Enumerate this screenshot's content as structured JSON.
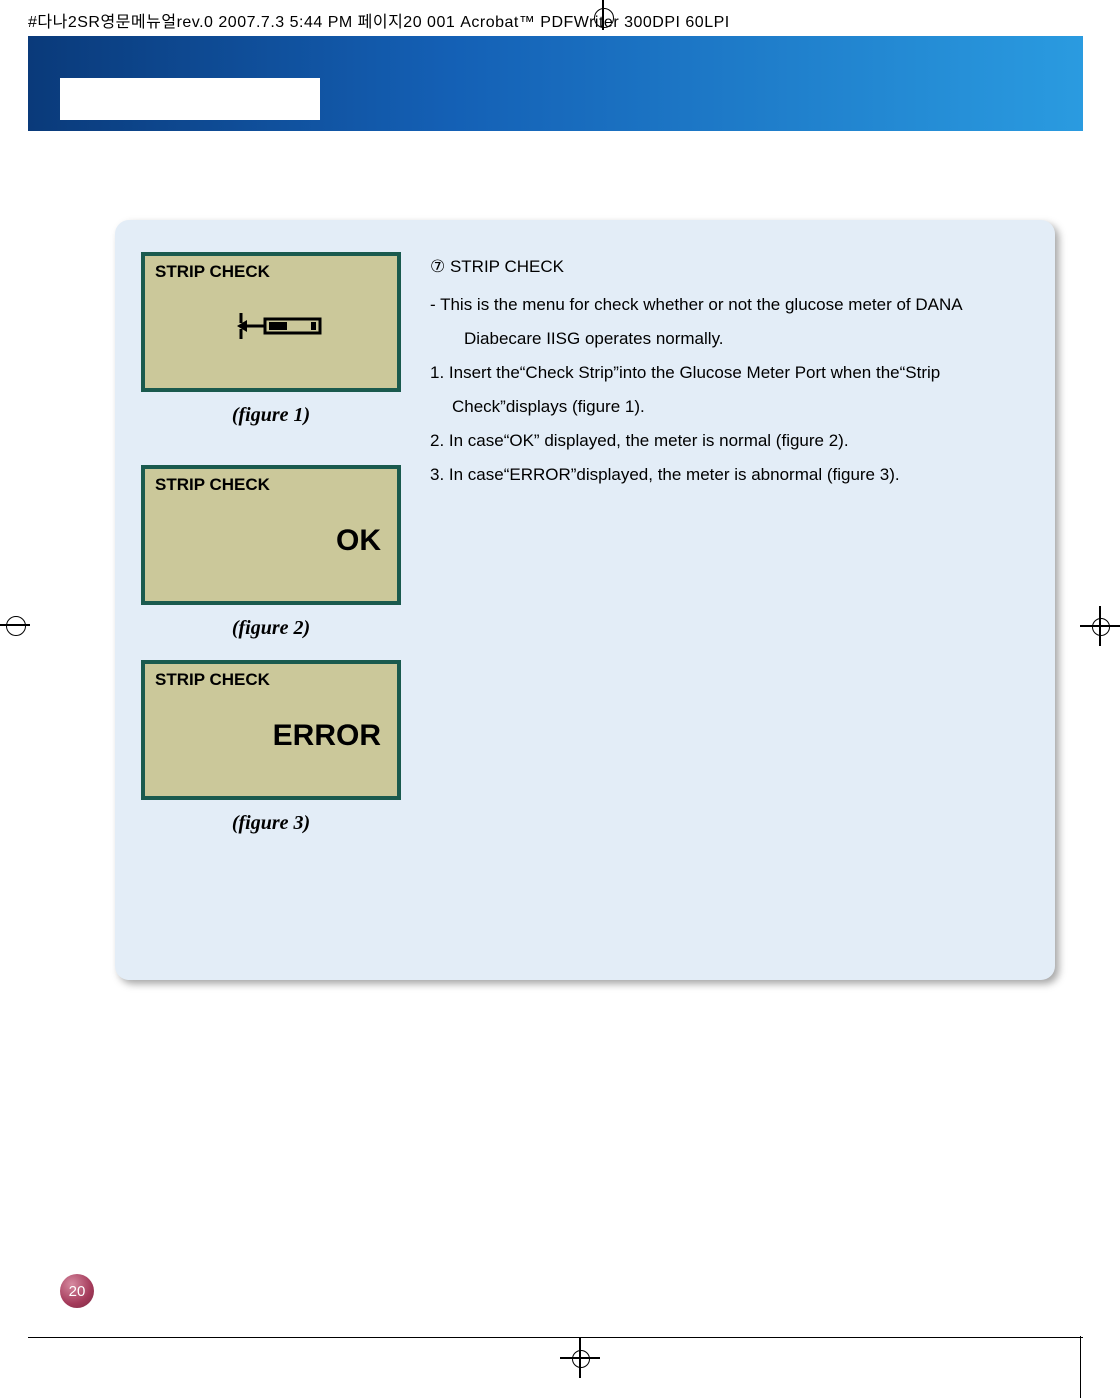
{
  "topHeader": "#다나2SR영문메뉴얼rev.0  2007.7.3 5:44 PM  페이지20   001 Acrobat™  PDFWriter 300DPI 60LPI",
  "figures": {
    "f1": {
      "label": "STRIP CHECK",
      "caption": "(figure 1)"
    },
    "f2": {
      "label": "STRIP CHECK",
      "value": "OK",
      "caption": "(figure 2)"
    },
    "f3": {
      "label": "STRIP CHECK",
      "value": "ERROR",
      "caption": "(figure 3)"
    }
  },
  "content": {
    "heading": "⑦ STRIP CHECK",
    "line1": "-   This is the menu for check whether or not the glucose meter of DANA",
    "line1b": "Diabecare IISG operates normally.",
    "line2": "1. Insert the“Check Strip”into the Glucose Meter Port when the“Strip",
    "line2b": "Check”displays (figure 1).",
    "line3": "2. In case“OK” displayed, the meter is normal (figure 2).",
    "line4": "3. In case“ERROR”displayed, the meter is abnormal (figure 3)."
  },
  "pageNumber": "20"
}
